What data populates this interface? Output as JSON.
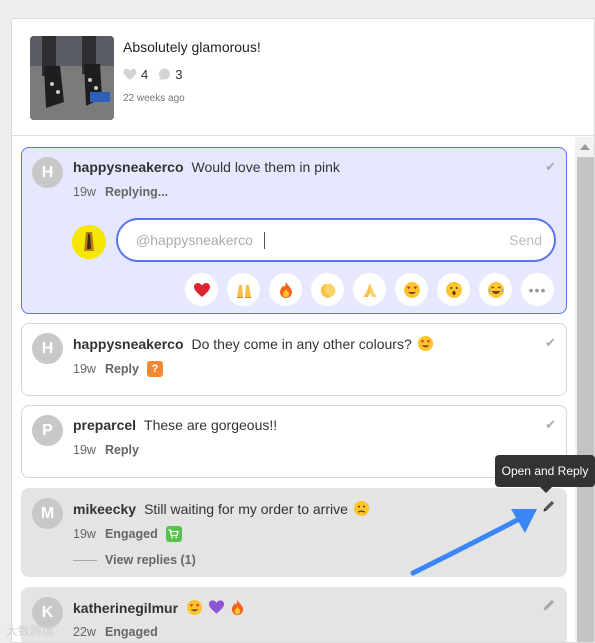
{
  "post": {
    "caption": "Absolutely glamorous!",
    "likes": "4",
    "comments": "3",
    "time": "22 weeks ago"
  },
  "comments": [
    {
      "avatar": "H",
      "username": "happysneakerco",
      "text": "Would love them in pink",
      "age": "19w",
      "action": "Replying...",
      "state": "active"
    },
    {
      "avatar": "H",
      "username": "happysneakerco",
      "text": "Do they come in any other colours?",
      "age": "19w",
      "action": "Reply",
      "badge": "?"
    },
    {
      "avatar": "P",
      "username": "preparcel",
      "text": "These are gorgeous!!",
      "age": "19w",
      "action": "Reply"
    },
    {
      "avatar": "M",
      "username": "mikeecky",
      "text": "Still waiting for my order to arrive",
      "age": "19w",
      "action": "Engaged",
      "view_replies": "View replies (1)"
    },
    {
      "avatar": "K",
      "username": "katherinegilmur",
      "text": "",
      "age": "22w",
      "action": "Engaged"
    }
  ],
  "reply": {
    "placeholder": "@happysneakerco",
    "send_label": "Send"
  },
  "emoji_options": [
    "heart",
    "raised-hands",
    "fire",
    "clap",
    "pray",
    "heart-eyes",
    "surprised",
    "laughing",
    "more"
  ],
  "tooltip": "Open and Reply",
  "watermark": "大数跨境",
  "colors": {
    "accent": "#5c72ee",
    "active_bg": "#e6e9fd",
    "engaged_bg": "#e4e4e4",
    "arrow": "#3a86f5"
  }
}
